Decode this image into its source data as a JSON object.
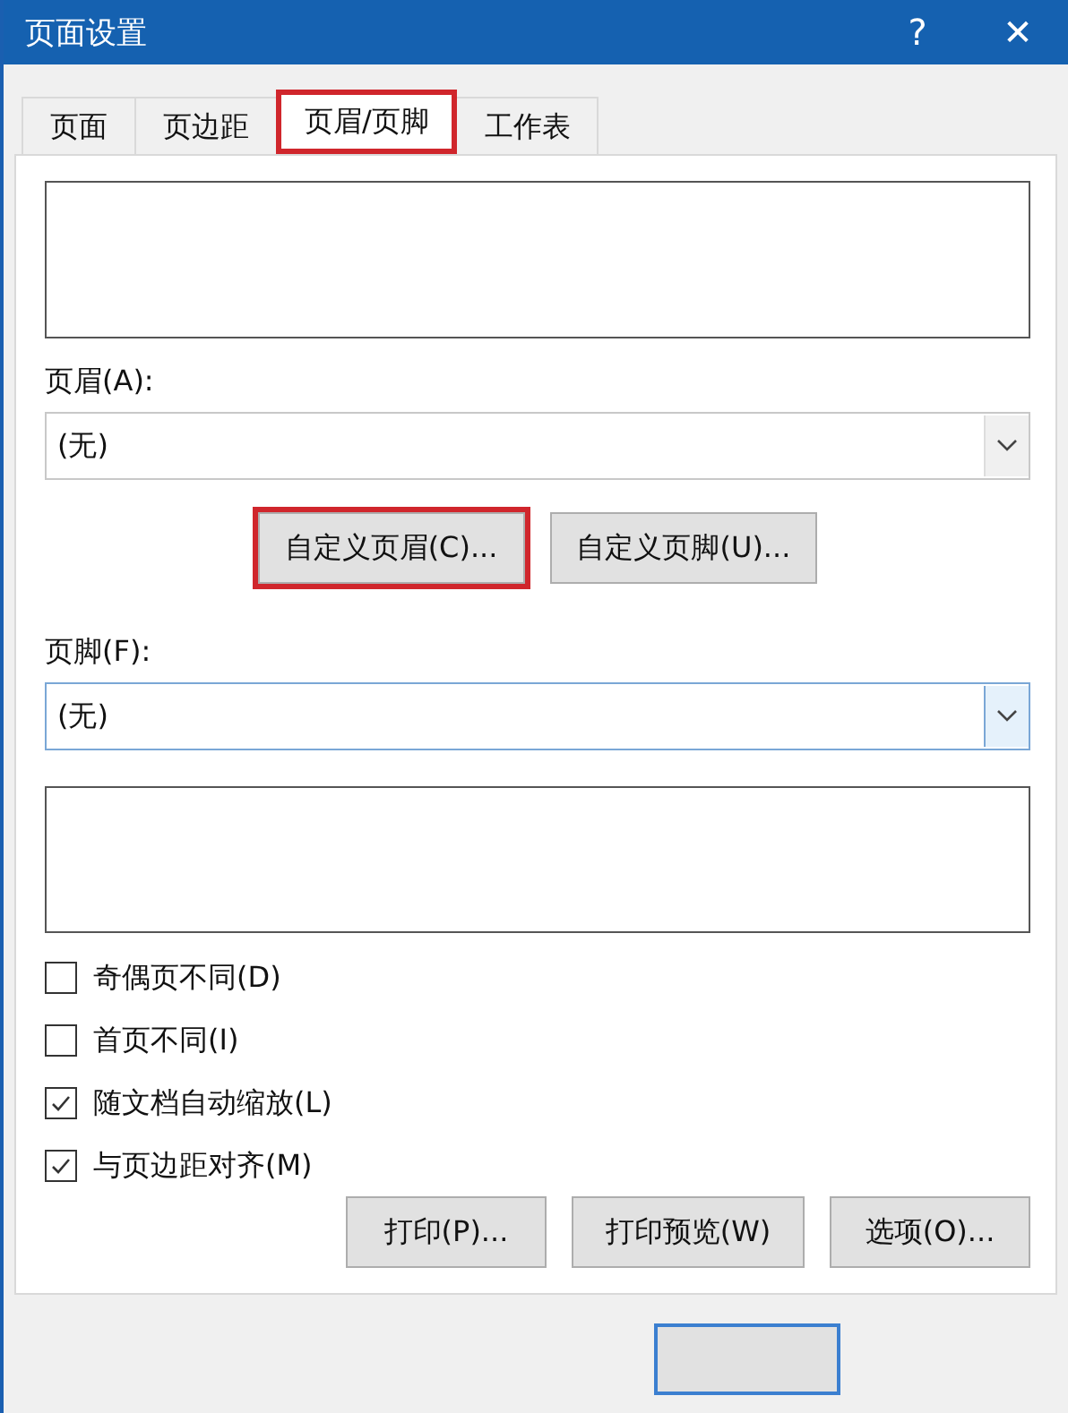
{
  "window": {
    "title": "页面设置",
    "help": "?",
    "close": "✕"
  },
  "tabs": [
    {
      "label": "页面",
      "selected": false,
      "highlighted": false
    },
    {
      "label": "页边距",
      "selected": false,
      "highlighted": false
    },
    {
      "label": "页眉/页脚",
      "selected": true,
      "highlighted": true
    },
    {
      "label": "工作表",
      "selected": false,
      "highlighted": false
    }
  ],
  "header": {
    "label": "页眉(A):",
    "value": "(无)",
    "focused": false
  },
  "custom_buttons": [
    {
      "label": "自定义页眉(C)...",
      "highlighted": true
    },
    {
      "label": "自定义页脚(U)...",
      "highlighted": false
    }
  ],
  "footer": {
    "label": "页脚(F):",
    "value": "(无)",
    "focused": true
  },
  "options": [
    {
      "label": "奇偶页不同(D)",
      "checked": false
    },
    {
      "label": "首页不同(I)",
      "checked": false
    },
    {
      "label": "随文档自动缩放(L)",
      "checked": true
    },
    {
      "label": "与页边距对齐(M)",
      "checked": true
    }
  ],
  "action_buttons": [
    "打印(P)...",
    "打印预览(W)",
    "选项(O)..."
  ],
  "bottom_button": {
    "default": true
  }
}
